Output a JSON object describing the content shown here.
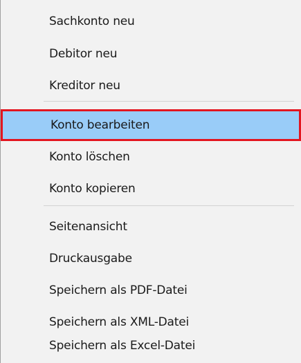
{
  "context_menu": {
    "groups": [
      {
        "items": [
          {
            "label": "Sachkonto neu"
          },
          {
            "label": "Debitor neu"
          },
          {
            "label": "Kreditor neu"
          }
        ]
      },
      {
        "items": [
          {
            "label": "Konto bearbeiten",
            "selected": true
          },
          {
            "label": "Konto löschen"
          },
          {
            "label": "Konto kopieren"
          }
        ]
      },
      {
        "items": [
          {
            "label": "Seitenansicht"
          },
          {
            "label": "Druckausgabe"
          },
          {
            "label": "Speichern als PDF-Datei"
          },
          {
            "label": "Speichern als XML-Datei"
          },
          {
            "label": "Speichern als Excel-Datei"
          }
        ]
      }
    ],
    "colors": {
      "background": "#f2f2f2",
      "highlight": "#99ccf8",
      "selection_outline": "#e3151f"
    }
  }
}
